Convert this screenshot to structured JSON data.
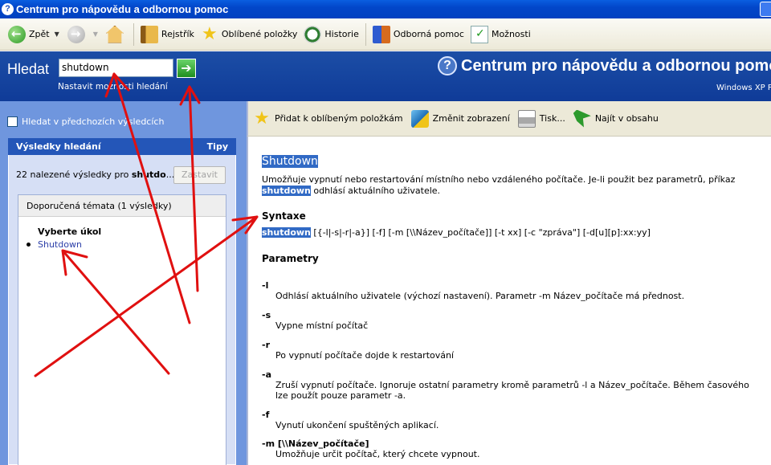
{
  "window": {
    "title": "Centrum pro nápovědu a odbornou pomoc"
  },
  "toolbar": {
    "back": "Zpět",
    "index": "Rejstřík",
    "favorites": "Oblíbené položky",
    "history": "Historie",
    "support": "Odborná pomoc",
    "options": "Možnosti"
  },
  "header": {
    "search_label": "Hledat",
    "search_value": "shutdown",
    "search_options": "Nastavit možnosti hledání",
    "title": "Centrum pro nápovědu a odbornou pomoc",
    "subtitle": "Windows XP P"
  },
  "left": {
    "prev_results": "Hledat v předchozích výsledcích",
    "results_title": "Výsledky hledání",
    "tips": "Tipy",
    "found_prefix": "22 nalezené výsledky pro ",
    "found_term": "shutdo",
    "found_ellipsis": "...",
    "stop": "Zastavit",
    "topics_header": "Doporučená témata (1 výsledky)",
    "task_title": "Vyberte úkol",
    "task_link": "Shutdown"
  },
  "content_toolbar": {
    "add_fav": "Přidat k oblíbeným položkám",
    "change_view": "Změnit zobrazení",
    "print": "Tisk...",
    "find_toc": "Najít v obsahu"
  },
  "content": {
    "title": "Shutdown",
    "desc1": "Umožňuje vypnutí nebo restartování místního nebo vzdáleného počítače. Je-li použit bez parametrů, příkaz",
    "desc2_cmd": "shutdown",
    "desc2_rest": " odhlásí aktuálního uživatele.",
    "syntax_heading": "Syntaxe",
    "syntax_cmd": "shutdown",
    "syntax_rest": " [{-l|-s|-r|-a}] [-f] [-m [\\\\Název_počítače]] [-t xx] [-c \"zpráva\"] [-d[u][p]:xx:yy]",
    "params_heading": "Parametry",
    "params": [
      {
        "key": "-l",
        "desc": "Odhlásí aktuálního uživatele (výchozí nastavení). Parametr -m Název_počítače má přednost."
      },
      {
        "key": "-s",
        "desc": "Vypne místní počítač"
      },
      {
        "key": "-r",
        "desc": "Po vypnutí počítače dojde k restartování"
      },
      {
        "key": "-a",
        "desc": "Zruší vypnutí počítače. Ignoruje ostatní parametry kromě parametrů -l a Název_počítače. Během časového",
        "desc2": "lze použít pouze parametr -a."
      },
      {
        "key": "-f",
        "desc": "Vynutí ukončení spuštěných aplikací."
      },
      {
        "key": "-m [\\\\Název_počítače]",
        "desc": "Umožňuje určit počítač, který chcete vypnout."
      }
    ]
  },
  "colors": {
    "annotation": "#e01010",
    "header_blue": "#1c4ea6",
    "highlight": "#316ac5"
  }
}
